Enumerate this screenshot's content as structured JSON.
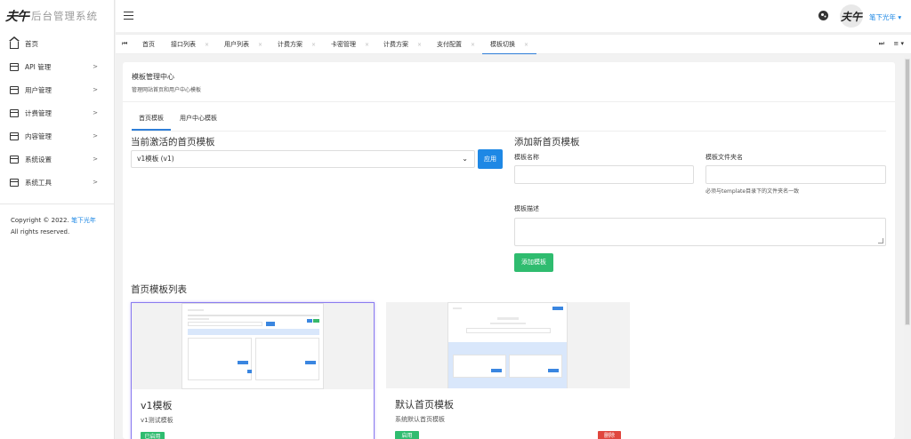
{
  "app": {
    "logo_mark": "夫午",
    "title": "后台管理系统"
  },
  "sidebar": {
    "items": [
      {
        "label": "首页",
        "icon": "home-icon"
      },
      {
        "label": "API 管理",
        "icon": "calendar-icon",
        "arrow": ">"
      },
      {
        "label": "用户管理",
        "icon": "calendar-icon",
        "arrow": ">"
      },
      {
        "label": "计费管理",
        "icon": "calendar-icon",
        "arrow": ">"
      },
      {
        "label": "内容管理",
        "icon": "calendar-icon",
        "arrow": ">"
      },
      {
        "label": "系统设置",
        "icon": "calendar-icon",
        "arrow": ">"
      },
      {
        "label": "系统工具",
        "icon": "calendar-icon",
        "arrow": ">"
      }
    ],
    "copyright_prefix": "Copyright © 2022.",
    "copyright_link": "笔下光年",
    "copyright_suffix": "All rights reserved."
  },
  "header": {
    "avatar_text": "夫午",
    "username": "笔下光年 ▾"
  },
  "tabs": {
    "prev_glyph": "⏮",
    "next_glyph": "⏭",
    "menu_glyph": "≡ ▾",
    "items": [
      {
        "label": "首页",
        "close": ""
      },
      {
        "label": "接口列表",
        "close": "×"
      },
      {
        "label": "用户列表",
        "close": "×"
      },
      {
        "label": "计费方案",
        "close": "×"
      },
      {
        "label": "卡密管理",
        "close": "×"
      },
      {
        "label": "计费方案",
        "close": "×"
      },
      {
        "label": "支付配置",
        "close": "×"
      },
      {
        "label": "模板切换",
        "close": "×"
      }
    ]
  },
  "page": {
    "title": "模板管理中心",
    "subtitle": "管理网站首页和用户中心模板",
    "inner_tabs": [
      "首页模板",
      "用户中心模板"
    ],
    "active_section_title": "当前激活的首页模板",
    "select_value": "v1模板 (v1)",
    "apply_label": "应用",
    "add_section_title": "添加新首页模板",
    "name_label": "模板名称",
    "folder_label": "模板文件夹名",
    "folder_hint": "必须与template目录下的文件夹名一致",
    "desc_label": "模板描述",
    "add_button": "添加模板",
    "list_title": "首页模板列表",
    "templates": [
      {
        "name": "v1模板",
        "desc": "v1测试模板",
        "badge": "已启用"
      },
      {
        "name": "默认首页模板",
        "desc": "系统默认首页模板",
        "badge": "启用",
        "delete": "删除"
      }
    ]
  },
  "colors": {
    "accent": "#1e88e5",
    "success": "#2fbc6f",
    "danger": "#e0463d"
  }
}
